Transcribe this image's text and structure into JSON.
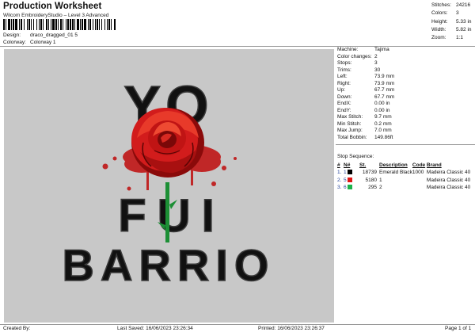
{
  "header": {
    "title": "Production Worksheet",
    "subtitle": "Wilcom EmbroideryStudio – Level 3 Advanced",
    "design_label": "Design:",
    "design_value": "draco_dragged_01 5",
    "colorway_label": "Colorway:",
    "colorway_value": "Colorway 1"
  },
  "top_stats": [
    {
      "k": "Stitches:",
      "v": "24216"
    },
    {
      "k": "Colors:",
      "v": "3"
    },
    {
      "k": "Height:",
      "v": "5.33 in"
    },
    {
      "k": "Width:",
      "v": "5.82 in"
    },
    {
      "k": "Zoom:",
      "v": "1:1"
    }
  ],
  "machine_info": [
    {
      "k": "Machine:",
      "v": "Tajima"
    },
    {
      "k": "Color changes:",
      "v": "2"
    },
    {
      "k": "Stops:",
      "v": "3"
    },
    {
      "k": "Trims:",
      "v": "30"
    },
    {
      "k": "Left:",
      "v": "73.9 mm"
    },
    {
      "k": "Right:",
      "v": "73.9 mm"
    },
    {
      "k": "Up:",
      "v": "67.7 mm"
    },
    {
      "k": "Down:",
      "v": "67.7 mm"
    },
    {
      "k": "EndX:",
      "v": "0.00 in"
    },
    {
      "k": "EndY:",
      "v": "0.00 in"
    },
    {
      "k": "Max Stitch:",
      "v": "9.7 mm"
    },
    {
      "k": "Min Stitch:",
      "v": "0.2 mm"
    },
    {
      "k": "Max Jump:",
      "v": "7.0 mm"
    },
    {
      "k": "Total Bobbin:",
      "v": "149.86ft"
    }
  ],
  "stop_sequence": {
    "title": "Stop Sequence:",
    "headers": {
      "num": "#",
      "n": "N#",
      "st": "St.",
      "desc": "Description",
      "code": "Code",
      "brand": "Brand"
    },
    "rows": [
      {
        "num": "1.",
        "n": "1",
        "color": "#000000",
        "st": "18739",
        "desc": "Emerald Black",
        "code": "1000",
        "brand": "Madeira Classic 40"
      },
      {
        "num": "2.",
        "n": "5",
        "color": "#e01515",
        "st": "5180",
        "desc": "1",
        "code": "",
        "brand": "Madeira Classic 40"
      },
      {
        "num": "3.",
        "n": "6",
        "color": "#1cb24a",
        "st": "295",
        "desc": "2",
        "code": "",
        "brand": "Madeira Classic 40"
      }
    ]
  },
  "design_text": {
    "line1": "YO",
    "line2": "FUI",
    "line3": "BARRIO"
  },
  "footer": {
    "created_by": "Created By:",
    "last_saved": "Last Saved: 16/06/2023 23:26:34",
    "printed": "Printed: 16/06/2023 23:26:37",
    "page": "Page 1 of 1"
  }
}
